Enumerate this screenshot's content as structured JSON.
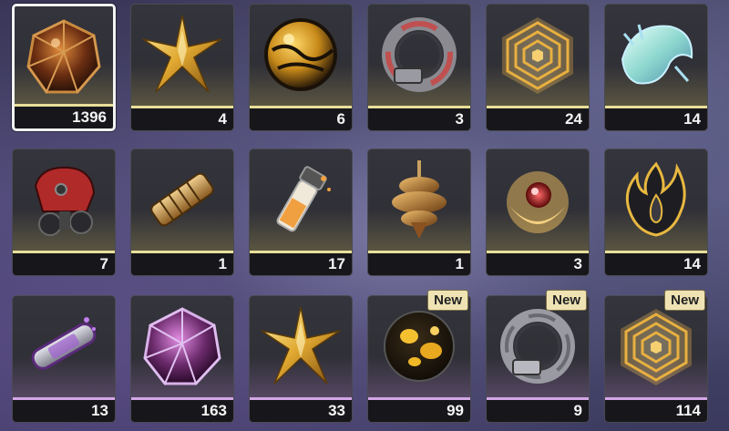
{
  "inventory": {
    "items": [
      {
        "icon": "brown-polyhedron-icon",
        "count": "1396",
        "rarity": "gold",
        "selected": true,
        "new_badge": ""
      },
      {
        "icon": "gold-star-shard-icon",
        "count": "4",
        "rarity": "gold",
        "selected": false,
        "new_badge": ""
      },
      {
        "icon": "amber-orb-icon",
        "count": "6",
        "rarity": "gold",
        "selected": false,
        "new_badge": ""
      },
      {
        "icon": "mechanical-ring-icon",
        "count": "3",
        "rarity": "gold",
        "selected": false,
        "new_badge": ""
      },
      {
        "icon": "golden-spiral-medallion-icon",
        "count": "24",
        "rarity": "gold",
        "selected": false,
        "new_badge": ""
      },
      {
        "icon": "crystal-shell-icon",
        "count": "14",
        "rarity": "gold",
        "selected": false,
        "new_badge": ""
      },
      {
        "icon": "red-gas-mask-icon",
        "count": "7",
        "rarity": "gold",
        "selected": false,
        "new_badge": ""
      },
      {
        "icon": "brass-cylinder-icon",
        "count": "1",
        "rarity": "gold",
        "selected": false,
        "new_badge": ""
      },
      {
        "icon": "broken-vial-icon",
        "count": "17",
        "rarity": "gold",
        "selected": false,
        "new_badge": ""
      },
      {
        "icon": "spinning-top-icon",
        "count": "1",
        "rarity": "gold",
        "selected": false,
        "new_badge": ""
      },
      {
        "icon": "red-core-orb-icon",
        "count": "3",
        "rarity": "gold",
        "selected": false,
        "new_badge": ""
      },
      {
        "icon": "black-flame-icon",
        "count": "14",
        "rarity": "gold",
        "selected": false,
        "new_badge": ""
      },
      {
        "icon": "purple-capsule-icon",
        "count": "13",
        "rarity": "purple",
        "selected": false,
        "new_badge": ""
      },
      {
        "icon": "purple-polyhedron-icon",
        "count": "163",
        "rarity": "purple",
        "selected": false,
        "new_badge": ""
      },
      {
        "icon": "gold-star-shard-icon",
        "count": "33",
        "rarity": "purple",
        "selected": false,
        "new_badge": ""
      },
      {
        "icon": "dark-amber-orb-icon",
        "count": "99",
        "rarity": "purple",
        "selected": false,
        "new_badge": "New"
      },
      {
        "icon": "silver-ring-icon",
        "count": "9",
        "rarity": "purple",
        "selected": false,
        "new_badge": "New"
      },
      {
        "icon": "golden-spiral-medallion-icon",
        "count": "114",
        "rarity": "purple",
        "selected": false,
        "new_badge": "New"
      }
    ]
  }
}
